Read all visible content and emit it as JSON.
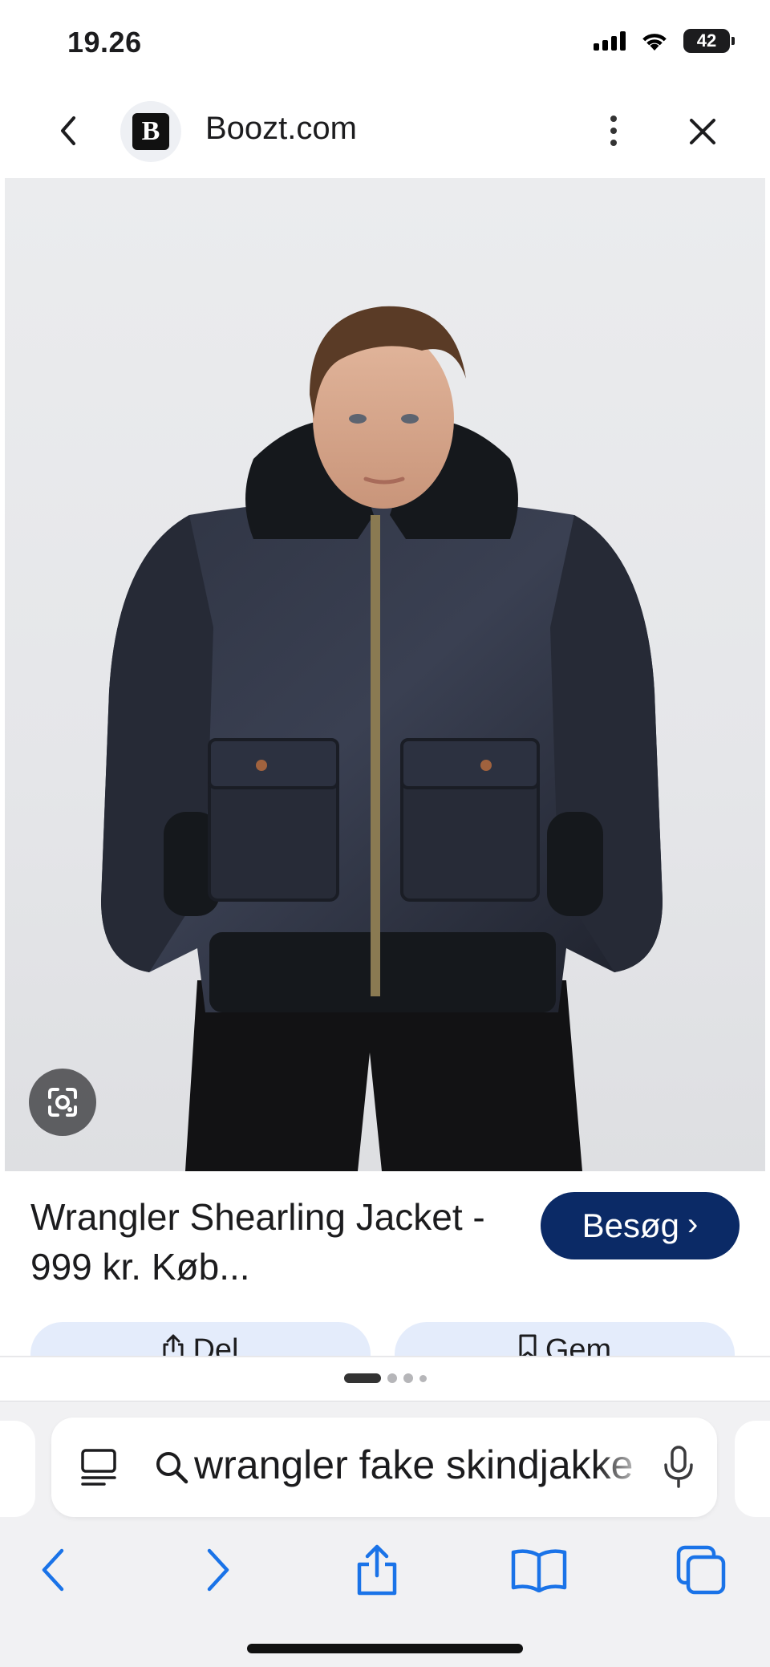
{
  "status_bar": {
    "time": "19.26",
    "battery": "42"
  },
  "header": {
    "site_initial": "B",
    "site_name": "Boozt.com"
  },
  "result": {
    "title": "Wrangler Shearling Jacket - 999 kr. Køb...",
    "visit_label": "Besøg",
    "share_label": "Del",
    "save_label": "Gem"
  },
  "search": {
    "query": "wrangler fake skindjakke"
  },
  "colors": {
    "visit_button": "#0b2a66",
    "toolbar_accent": "#1a73e8",
    "pill_background": "#e4ecfb"
  },
  "icons": {
    "nav": [
      "chevron-left-icon",
      "kebab-menu-icon",
      "close-icon"
    ],
    "image": [
      "google-lens-icon"
    ],
    "address_bar": [
      "reader-mode-icon",
      "search-icon",
      "microphone-icon"
    ],
    "toolbar": [
      "back-arrow-icon",
      "forward-arrow-icon",
      "share-icon",
      "bookmarks-icon",
      "tabs-icon"
    ]
  }
}
